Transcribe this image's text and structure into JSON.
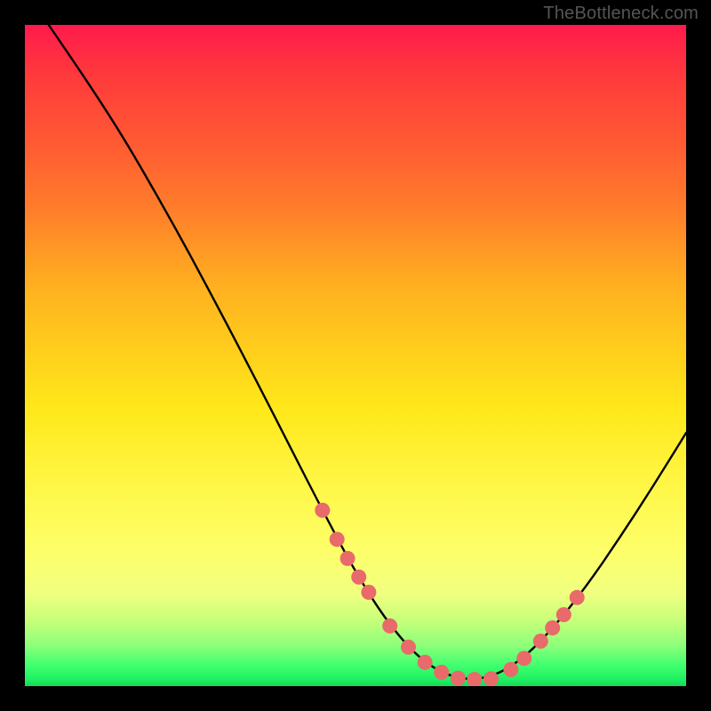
{
  "attribution": "TheBottleneck.com",
  "chart_data": {
    "type": "line",
    "title": "",
    "xlabel": "",
    "ylabel": "",
    "xlim": [
      0,
      100
    ],
    "ylim": [
      0,
      100
    ],
    "curve": {
      "name": "bottleneck-curve",
      "x": [
        3.6,
        10,
        15,
        20,
        25,
        30,
        35,
        40,
        45,
        50,
        55,
        60,
        65,
        70,
        75,
        80,
        85,
        90,
        95,
        100
      ],
      "y": [
        100,
        90.6,
        82.8,
        74.2,
        65.2,
        55.8,
        46.2,
        36.4,
        26.6,
        17.2,
        9.4,
        3.8,
        1.1,
        1.1,
        3.8,
        8.9,
        15.2,
        22.5,
        30.2,
        38.3
      ]
    },
    "markers": {
      "name": "highlight-dots",
      "color": "#e86a6a",
      "x": [
        45.0,
        47.2,
        48.8,
        50.5,
        52.0,
        55.2,
        58.0,
        60.5,
        63.0,
        65.5,
        68.0,
        70.5,
        73.5,
        75.5,
        78.0,
        79.8,
        81.5,
        83.5
      ],
      "y": [
        26.6,
        22.2,
        19.3,
        16.5,
        14.2,
        9.1,
        5.9,
        3.6,
        2.1,
        1.2,
        1.0,
        1.1,
        2.5,
        4.2,
        6.8,
        8.8,
        10.8,
        13.4
      ]
    },
    "grid": false,
    "legend": false
  }
}
